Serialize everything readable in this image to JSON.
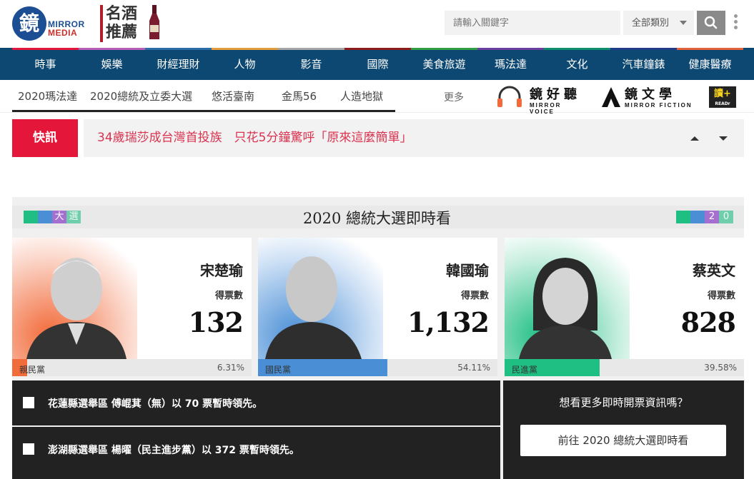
{
  "header": {
    "logo_glyph": "鏡",
    "logo_mirror": "MIRROR",
    "logo_media": "MEDIA",
    "wine_line1": "名酒",
    "wine_line2": "推薦",
    "search_placeholder": "請輸入關鍵字",
    "category_label": "全部類別"
  },
  "nav": {
    "items": [
      {
        "label": "時事",
        "color": "#e4173b"
      },
      {
        "label": "娛樂",
        "color": "#b75fb7"
      },
      {
        "label": "財經理財",
        "color": "#2e6ca8"
      },
      {
        "label": "人物",
        "color": "#e59c3a"
      },
      {
        "label": "影音",
        "color": "#a5a5a5"
      },
      {
        "label": "國際",
        "color": "#8e1c1c"
      },
      {
        "label": "美食旅遊",
        "color": "#2f9e44"
      },
      {
        "label": "瑪法達",
        "color": "#6a3fa0"
      },
      {
        "label": "文化",
        "color": "#0f8f6d"
      },
      {
        "label": "汽車鐘錶",
        "color": "#1f3c88"
      },
      {
        "label": "健康醫療",
        "color": "#e3623c"
      }
    ]
  },
  "subnav": {
    "items": [
      "2020瑪法達",
      "2020總統及立委大選",
      "悠活臺南",
      "金馬56",
      "人造地獄"
    ],
    "more_label": "更多",
    "partners": [
      {
        "title": "鏡好聽",
        "sub": "MIRROR VOICE"
      },
      {
        "title": "鏡文學",
        "sub": "MIRROR FICTION"
      },
      {
        "title": "讀+",
        "sub": "READr"
      }
    ]
  },
  "breaking": {
    "label": "快訊",
    "text": "34歲瑞莎成台灣首投族　只花5分鐘驚呼「原來這麼簡單」"
  },
  "election": {
    "title": "2020 總統大選即時看",
    "left_tags": [
      {
        "text": "",
        "color": "#1fbf84"
      },
      {
        "text": "",
        "color": "#4a8fd6"
      },
      {
        "text": "大",
        "color": "#a56fd0"
      },
      {
        "text": "選",
        "color": "#1fbf84"
      }
    ],
    "right_tags": [
      {
        "text": "",
        "color": "#1fbf84"
      },
      {
        "text": "",
        "color": "#4a8fd6"
      },
      {
        "text": "2",
        "color": "#a56fd0"
      },
      {
        "text": "0",
        "color": "#1fbf84"
      }
    ],
    "votes_label": "得票數",
    "candidates": [
      {
        "name": "宋楚瑜",
        "votes": "132",
        "party": "親民黨",
        "percent": "6.31%",
        "share": 0.0631,
        "color": "#f26b3a"
      },
      {
        "name": "韓國瑜",
        "votes": "1,132",
        "party": "國民黨",
        "percent": "54.11%",
        "share": 0.5411,
        "color": "#4a8fd6"
      },
      {
        "name": "蔡英文",
        "votes": "828",
        "party": "民進黨",
        "percent": "39.58%",
        "share": 0.3958,
        "color": "#1fbf84"
      }
    ],
    "leads": [
      "花蓮縣選舉區 傅崐萁（無）以 70 票暫時領先。",
      "澎湖縣選舉區 楊曜（民主進步黨）以 372 票暫時領先。"
    ],
    "more_question": "想看更多即時開票資訊嗎？",
    "more_button": "前往 2020 總統大選即時看"
  }
}
